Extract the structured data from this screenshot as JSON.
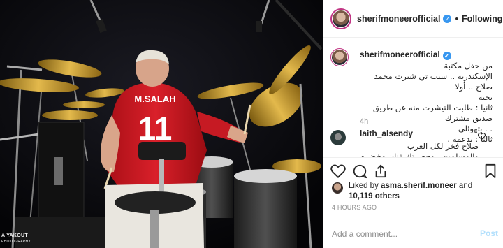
{
  "photo": {
    "shirt_name": "M.SALAH",
    "shirt_number": "11",
    "watermark_line1": "A YAKOUT",
    "watermark_line2": "PHOTOGRAPHY"
  },
  "header": {
    "username": "sherifmoneerofficial",
    "verified_glyph": "✓",
    "separator": "•",
    "follow_label": "Following"
  },
  "caption": {
    "username": "sherifmoneerofficial",
    "lines": [
      "من حفل مكتبة",
      "الإسكندرية .. سبب تي شيرت محمد صلاح .. أولا",
      "بحبه",
      "ثانيا : طلبت التيشرت منه عن طريق صديق مشترك",
      ". . يتهوئلي",
      "ثالثا : بدعمه ."
    ],
    "time": "4h"
  },
  "comment": {
    "username": "laith_alsendy",
    "text_line1": "صلاح فخر لكل العرب",
    "text_line2": "والمسلمين ، وحضرتك فنان مخضرم ❤️"
  },
  "icons": {
    "heart": "heart-icon",
    "comment": "comment-icon",
    "share": "share-icon",
    "save": "bookmark-icon"
  },
  "likes": {
    "prefix": "Liked by",
    "user": "asma.sherif.moneer",
    "and": "and",
    "count": "10,119 others"
  },
  "timestamp": "4 HOURS AGO",
  "add_comment": {
    "placeholder": "Add a comment...",
    "post_label": "Post"
  },
  "colors": {
    "link_blue": "#3897f0",
    "post_disabled": "#b2dffc",
    "shirt_red": "#d0151e"
  }
}
